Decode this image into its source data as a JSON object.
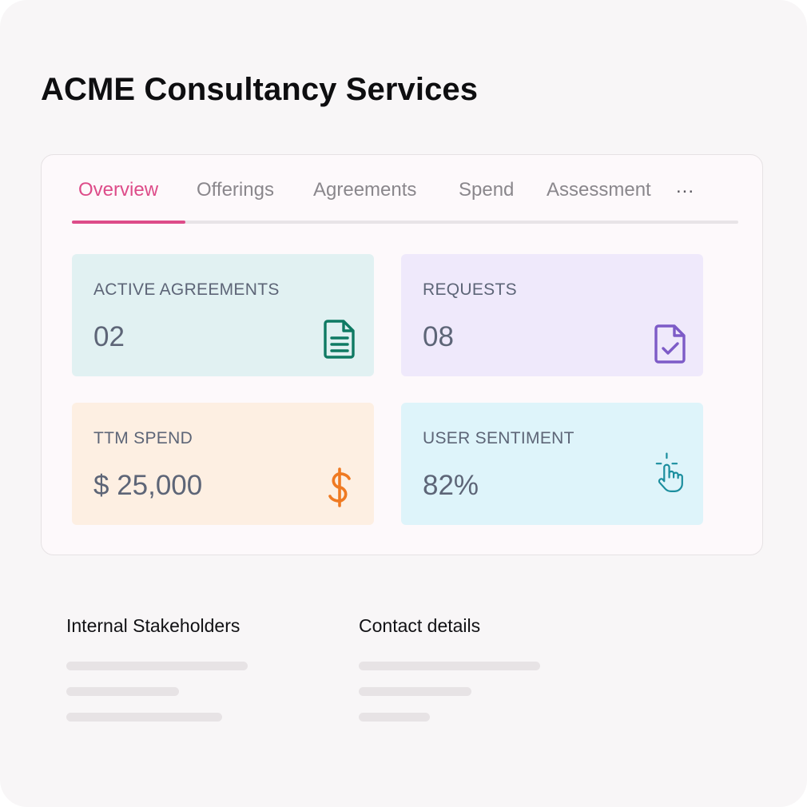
{
  "company": {
    "name": "ACME Consultancy Services"
  },
  "tabs": [
    {
      "label": "Overview",
      "active": true
    },
    {
      "label": "Offerings",
      "active": false
    },
    {
      "label": "Agreements",
      "active": false
    },
    {
      "label": "Spend",
      "active": false
    },
    {
      "label": "Assessment",
      "active": false
    }
  ],
  "tabs_more": "...",
  "stats": [
    {
      "label": "ACTIVE AGREEMENTS",
      "value": "02",
      "icon": "document-icon",
      "icon_color": "#0f7a63",
      "bg_color": "#e1f1f2"
    },
    {
      "label": "REQUESTS",
      "value": "08",
      "icon": "document-check-icon",
      "icon_color": "#7d5bc7",
      "bg_color": "#efe9fb"
    },
    {
      "label": "TTM SPEND",
      "value": "$ 25,000",
      "icon": "dollar-icon",
      "icon_color": "#ef7a22",
      "bg_color": "#fdefe2"
    },
    {
      "label": "USER SENTIMENT",
      "value": "82%",
      "icon": "tap-hand-icon",
      "icon_color": "#1b8e9e",
      "bg_color": "#def4fa"
    }
  ],
  "sections": {
    "stakeholders": {
      "title": "Internal Stakeholders"
    },
    "contact": {
      "title": "Contact details"
    }
  },
  "colors": {
    "accent": "#dd4c89",
    "background": "#f8f6f7",
    "muted_text": "#8a878c"
  }
}
